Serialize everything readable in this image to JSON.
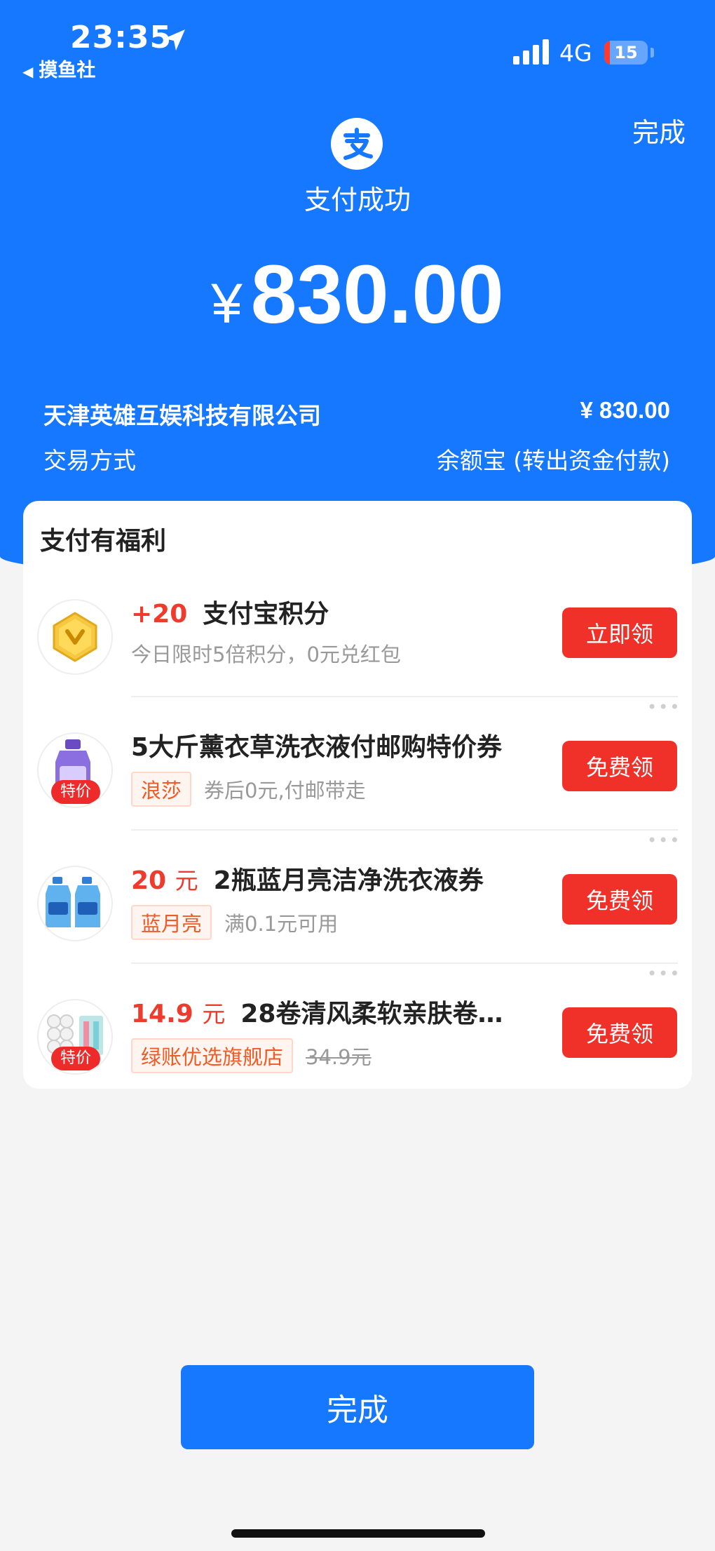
{
  "status_bar": {
    "time": "23:35",
    "back_app": "摸鱼社",
    "network": "4G",
    "battery": "15"
  },
  "header": {
    "done_label": "完成",
    "title": "支付成功",
    "currency": "¥",
    "amount": "830.00"
  },
  "transaction": {
    "merchant": "天津英雄互娱科技有限公司",
    "merchant_amount": "¥ 830.00",
    "method_label": "交易方式",
    "method_value": "余额宝 (转出资金付款)"
  },
  "benefits": {
    "title": "支付有福利",
    "items": [
      {
        "highlight": "+20",
        "title": "支付宝积分",
        "subtitle": "今日限时5倍积分，0元兑红包",
        "button": "立即领",
        "icon": "gold-coin-icon"
      },
      {
        "title": "5大斤薰衣草洗衣液付邮购特价券",
        "tag": "浪莎",
        "subtitle": "券后0元,付邮带走",
        "badge": "特价",
        "button": "免费领",
        "icon": "laundry-detergent-bottle-icon"
      },
      {
        "highlight": "20",
        "highlight_unit": "元",
        "title": "2瓶蓝月亮洁净洗衣液券",
        "tag": "蓝月亮",
        "subtitle": "满0.1元可用",
        "button": "免费领",
        "icon": "detergent-bottles-icon"
      },
      {
        "highlight": "14.9",
        "highlight_unit": "元",
        "title": "28卷清风柔软亲肤卷…",
        "tag": "绿账优选旗舰店",
        "original_price": "34.9元",
        "badge": "特价",
        "button": "免费领",
        "icon": "tissue-rolls-icon"
      }
    ]
  },
  "footer": {
    "done_label": "完成"
  },
  "colors": {
    "brand_blue": "#1677ff",
    "claim_red": "#f0312a",
    "highlight_red": "#ef3b2e"
  }
}
